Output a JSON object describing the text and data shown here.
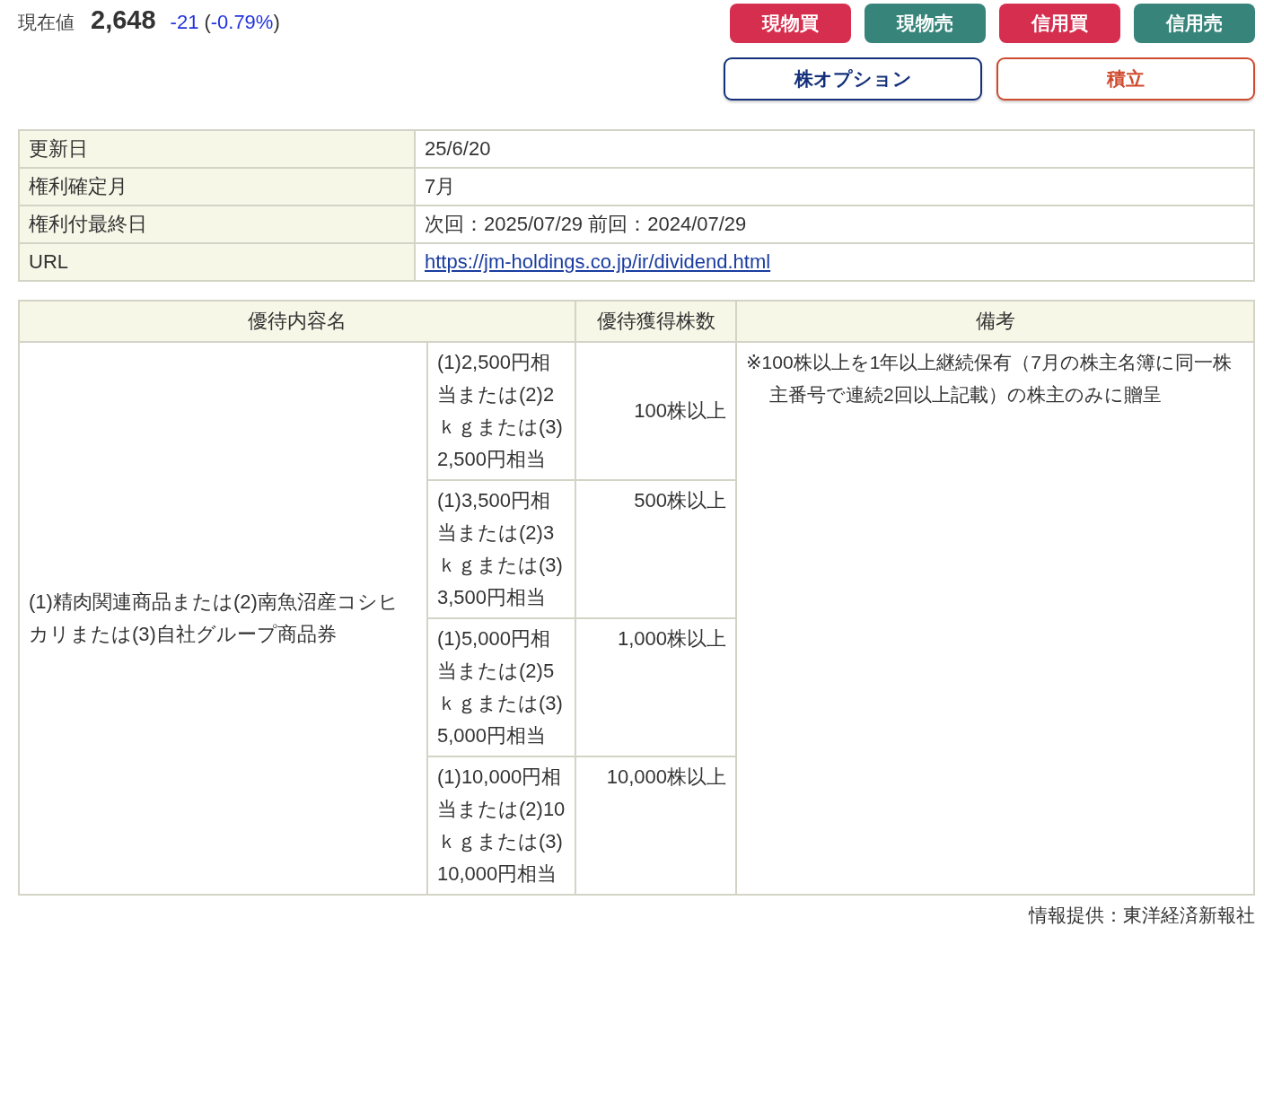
{
  "price": {
    "label": "現在値",
    "value": "2,648",
    "change": "-21",
    "paren_open": "(",
    "change_pct": "-0.79%",
    "paren_close": ")"
  },
  "trade_buttons": [
    {
      "label": "現物買",
      "kind": "buy"
    },
    {
      "label": "現物売",
      "kind": "sell"
    },
    {
      "label": "信用買",
      "kind": "buy"
    },
    {
      "label": "信用売",
      "kind": "sell"
    }
  ],
  "other_buttons": [
    {
      "label": "株オプション",
      "kind": "navy"
    },
    {
      "label": "積立",
      "kind": "orange"
    }
  ],
  "info_table": [
    {
      "label": "更新日",
      "value": "25/6/20",
      "kind": "text"
    },
    {
      "label": "権利確定月",
      "value": "7月",
      "kind": "text"
    },
    {
      "label": "権利付最終日",
      "value": "次回：2025/07/29 前回：2024/07/29",
      "kind": "text"
    },
    {
      "label": "URL",
      "value": "https://jm-holdings.co.jp/ir/dividend.html",
      "kind": "link"
    }
  ],
  "benefits_table": {
    "columns": [
      "優待内容名",
      "優待獲得株数",
      "備考"
    ],
    "name": "(1)精肉関連商品または(2)南魚沼産コシヒカリまたは(3)自社グループ商品券",
    "tiers": [
      {
        "content": "(1)2,500円相当または(2)2ｋｇまたは(3)2,500円相当",
        "shares": "100株以上"
      },
      {
        "content": "(1)3,500円相当または(2)3ｋｇまたは(3)3,500円相当",
        "shares": "500株以上"
      },
      {
        "content": "(1)5,000円相当または(2)5ｋｇまたは(3)5,000円相当",
        "shares": "1,000株以上"
      },
      {
        "content": "(1)10,000円相当または(2)10ｋｇまたは(3)10,000円相当",
        "shares": "10,000株以上"
      }
    ],
    "note": "※100株以上を1年以上継続保有（7月の株主名簿に同一株主番号で連続2回以上記載）の株主のみに贈呈"
  },
  "source": "情報提供：東洋経済新報社"
}
